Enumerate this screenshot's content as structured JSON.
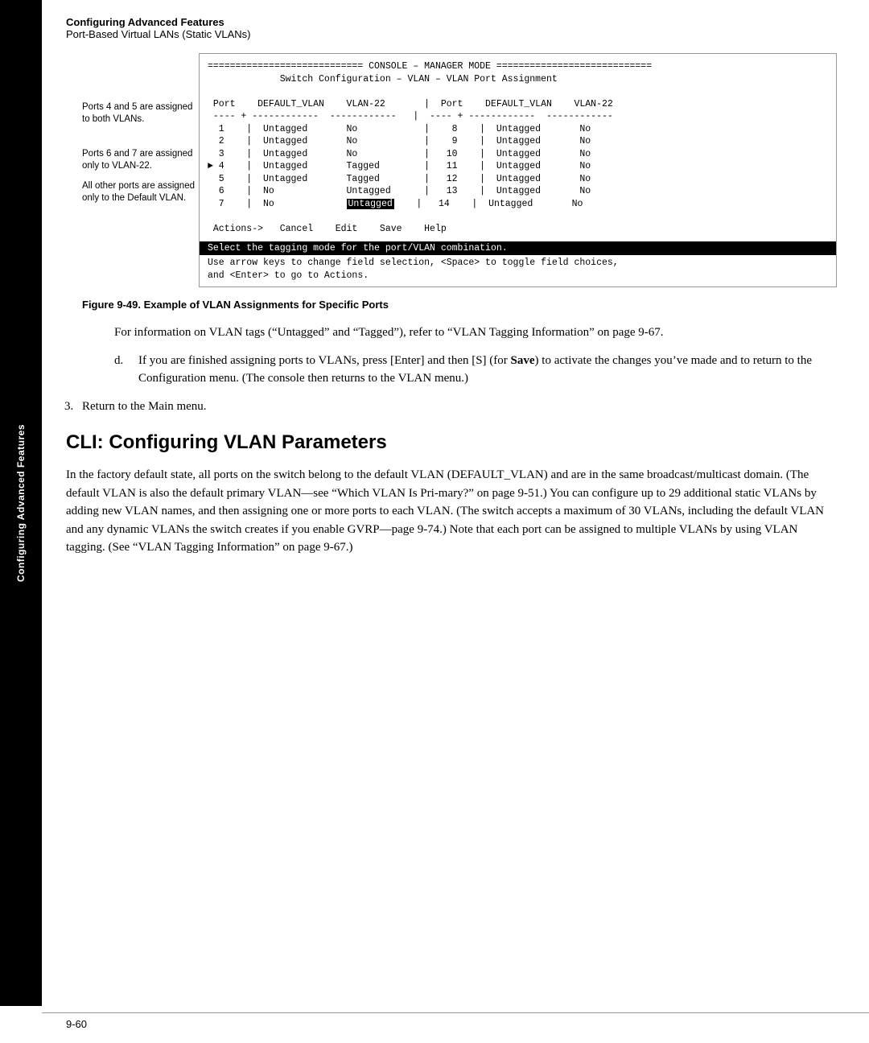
{
  "sidebar": {
    "label": "Configuring Advanced Features"
  },
  "header": {
    "bold_title": "Configuring Advanced Features",
    "subtitle": "Port-Based Virtual LANs (Static VLANs)"
  },
  "console": {
    "title_line": "============================ CONSOLE – MANAGER MODE ============================",
    "subtitle_line": "             Switch Configuration – VLAN – VLAN Port Assignment",
    "blank": "",
    "col_header": " Port    DEFAULT_VLAN    VLAN-22       |  Port    DEFAULT_VLAN    VLAN-22",
    "col_divider": " ---- + ------------  ------------   |  ---- + ------------  ------------",
    "rows": [
      "  1    |  Untagged       No            |    8    |  Untagged       No",
      "  2    |  Untagged       No            |    9    |  Untagged       No",
      "  3    |  Untagged       No            |   10    |  Untagged       No",
      "▶ 4    |  Untagged       Tagged        |   11    |  Untagged       No",
      "  5    |  Untagged       Tagged        |   12    |  Untagged       No",
      "  6    |  No             Untagged      |   13    |  Untagged       No",
      "  7    |  No             [Untagged]    |   14    |  Untagged       No"
    ],
    "blank2": "",
    "actions_line": " Actions->   Cancel    Edit    Save    Help",
    "status_bar": "Select the tagging mode for the port/VLAN combination.",
    "hint_line1": "Use arrow keys to change field selection, <Space> to toggle field choices,",
    "hint_line2": "and <Enter> to go to Actions."
  },
  "annotations": {
    "ann1": "Ports 4 and 5 are assigned to both VLANs.",
    "ann2": "Ports 6 and 7 are assigned only to VLAN-22.",
    "ann3": "All other ports are assigned only to the Default VLAN."
  },
  "figure_caption": "Figure 9-49.  Example of VLAN Assignments for Specific Ports",
  "body": {
    "para1": "For information on VLAN tags (“Untagged” and “Tagged”), refer to “VLAN Tagging Information” on page 9-67.",
    "list_d_text1": "If you are finished assigning ports to VLANs, press [Enter] and then [S] (for ",
    "list_d_bold": "Save",
    "list_d_text2": ") to activate the changes you’ve made and to return to the Configuration menu. (The console then returns to the VLAN menu.)",
    "list_d_label": "d.",
    "item3_label": "3.",
    "item3_text": "Return to the Main menu.",
    "section_heading": "CLI: Configuring VLAN Parameters",
    "main_para": "In the factory default state, all ports on the switch belong to the default VLAN (DEFAULT_VLAN) and are in the same broadcast/multicast domain.  (The default VLAN is also the default primary VLAN—see “Which VLAN Is Pri-mary?” on page 9-51.) You can configure up to 29 additional static VLANs by adding new VLAN names, and then assigning one or more ports to each VLAN. (The switch accepts a maximum of 30 VLANs, including the default VLAN and any dynamic VLANs the switch creates if you enable GVRP—page 9-74.) Note that each port can be assigned to multiple VLANs by using VLAN tagging. (See “VLAN Tagging Information” on page 9-67.)"
  },
  "footer": {
    "page_number": "9-60"
  }
}
